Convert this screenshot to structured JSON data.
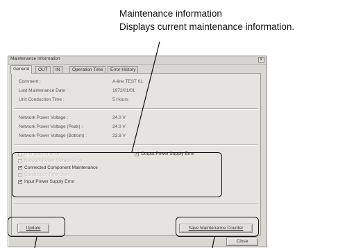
{
  "callout": {
    "title": "Maintenance information",
    "description": "Displays current maintenance information."
  },
  "window": {
    "title": "Maintenance Information",
    "close_glyph": "×",
    "tabs": [
      "General",
      "OUT",
      "IN",
      "Operation Time",
      "Error History"
    ],
    "active_tab": "General"
  },
  "info": {
    "comment_label": "Comment :",
    "comment_value": "A-line TEST 01",
    "last_date_label": "Last Maintenance Date :",
    "last_date_value": "1972/01/01",
    "conduction_label": "Unit Conduction Time :",
    "conduction_value": "5 Hours",
    "voltage_label": "Network Power Voltage :",
    "voltage_value": "24.0 V",
    "voltage_peak_label": "Network Power Voltage (Peak) :",
    "voltage_peak_value": "24.0 V",
    "voltage_bottom_label": "Network Power Voltage (Bottom) :",
    "voltage_bottom_value": "23.8 V"
  },
  "checks": [
    {
      "label": "Unit Maintenance",
      "checked": false,
      "enabled": false
    },
    {
      "label": "Network Power Voltage Drop",
      "checked": false,
      "enabled": false
    },
    {
      "label": "Connected Component Maintenance",
      "checked": true,
      "enabled": true
    },
    {
      "label": "Conduction Time Over",
      "checked": false,
      "enabled": false
    },
    {
      "label": "Input Power Supply Error",
      "checked": true,
      "enabled": true
    },
    {
      "label": "Output Power Supply Error",
      "checked": true,
      "enabled": true
    }
  ],
  "check_glyph": "✓",
  "buttons": {
    "update": "Update",
    "save_counter": "Save Maintenance Counter",
    "close": "Close"
  }
}
